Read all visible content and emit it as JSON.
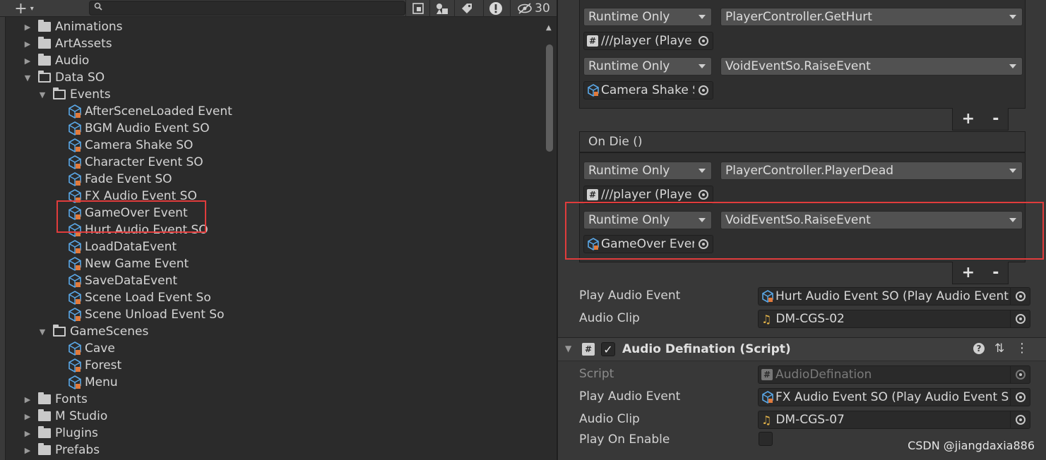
{
  "toolbar": {
    "add_label": "+",
    "add_caret": "▾",
    "search_placeholder": "",
    "icons": [
      "scene-view-icon",
      "filter-by-type-icon",
      "label-tag-icon",
      "warning-icon"
    ],
    "hidden_count": "30"
  },
  "tree": {
    "items": [
      {
        "label": "Animations",
        "type": "folder",
        "expanded": false
      },
      {
        "label": "ArtAssets",
        "type": "folder",
        "expanded": false
      },
      {
        "label": "Audio",
        "type": "folder",
        "expanded": false
      },
      {
        "label": "Data SO",
        "type": "folder",
        "expanded": true
      },
      {
        "label": "Events",
        "type": "folder",
        "expanded": true
      },
      {
        "label": "AfterSceneLoaded Event",
        "type": "asset"
      },
      {
        "label": "BGM Audio Event SO",
        "type": "asset"
      },
      {
        "label": "Camera Shake SO",
        "type": "asset"
      },
      {
        "label": "Character Event SO",
        "type": "asset"
      },
      {
        "label": "Fade Event SO",
        "type": "asset"
      },
      {
        "label": "FX Audio Event SO",
        "type": "asset"
      },
      {
        "label": "GameOver Event",
        "type": "asset"
      },
      {
        "label": "Hurt Audio Event SO",
        "type": "asset"
      },
      {
        "label": "LoadDataEvent",
        "type": "asset"
      },
      {
        "label": "New Game Event",
        "type": "asset"
      },
      {
        "label": "SaveDataEvent",
        "type": "asset"
      },
      {
        "label": "Scene Load Event So",
        "type": "asset"
      },
      {
        "label": "Scene Unload Event So",
        "type": "asset"
      },
      {
        "label": "GameScenes",
        "type": "folder",
        "expanded": true
      },
      {
        "label": "Cave",
        "type": "asset"
      },
      {
        "label": "Forest",
        "type": "asset"
      },
      {
        "label": "Menu",
        "type": "asset"
      },
      {
        "label": "Fonts",
        "type": "folder",
        "expanded": false
      },
      {
        "label": "M Studio",
        "type": "folder",
        "expanded": false
      },
      {
        "label": "Plugins",
        "type": "folder",
        "expanded": false
      },
      {
        "label": "Prefabs",
        "type": "folder",
        "expanded": false
      }
    ]
  },
  "inspector": {
    "on_hurt": {
      "listeners": [
        {
          "mode": "Runtime Only",
          "function": "PlayerController.GetHurt",
          "target": "///player (Playe"
        },
        {
          "mode": "Runtime Only",
          "function": "VoidEventSo.RaiseEvent",
          "target": "Camera Shake S"
        }
      ],
      "plus": "+",
      "minus": "-"
    },
    "on_die": {
      "header": "On Die ()",
      "listeners": [
        {
          "mode": "Runtime Only",
          "function": "PlayerController.PlayerDead",
          "target": "///player (Playe"
        },
        {
          "mode": "Runtime Only",
          "function": "VoidEventSo.RaiseEvent",
          "target": "GameOver Ever"
        }
      ],
      "plus": "+",
      "minus": "-"
    },
    "fields_1": {
      "play_audio_event_label": "Play Audio Event",
      "play_audio_event_value": "Hurt Audio Event SO (Play Audio Event",
      "audio_clip_label": "Audio Clip",
      "audio_clip_value": "DM-CGS-02"
    },
    "component": {
      "title": "Audio Defination (Script)",
      "enabled_mark": "✓",
      "help": "?",
      "settings": "⇅",
      "menu": "⋮",
      "script_label": "Script",
      "script_value": "AudioDefination",
      "play_audio_event_label": "Play Audio Event",
      "play_audio_event_value": "FX Audio Event SO (Play Audio Event S",
      "audio_clip_label": "Audio Clip",
      "audio_clip_value": "DM-CGS-07",
      "play_on_enable_label": "Play On Enable",
      "play_on_enable_checked": false
    }
  },
  "watermark": "CSDN @jiangdaxia886",
  "colors": {
    "highlight": "#e03c3c",
    "panel_bg": "#383838",
    "project_bg": "#2b2b2b",
    "cube_icon": "#5aa7e6",
    "cube_badge": "#e07a3c",
    "audio_clip_icon": "#e5b54a"
  }
}
